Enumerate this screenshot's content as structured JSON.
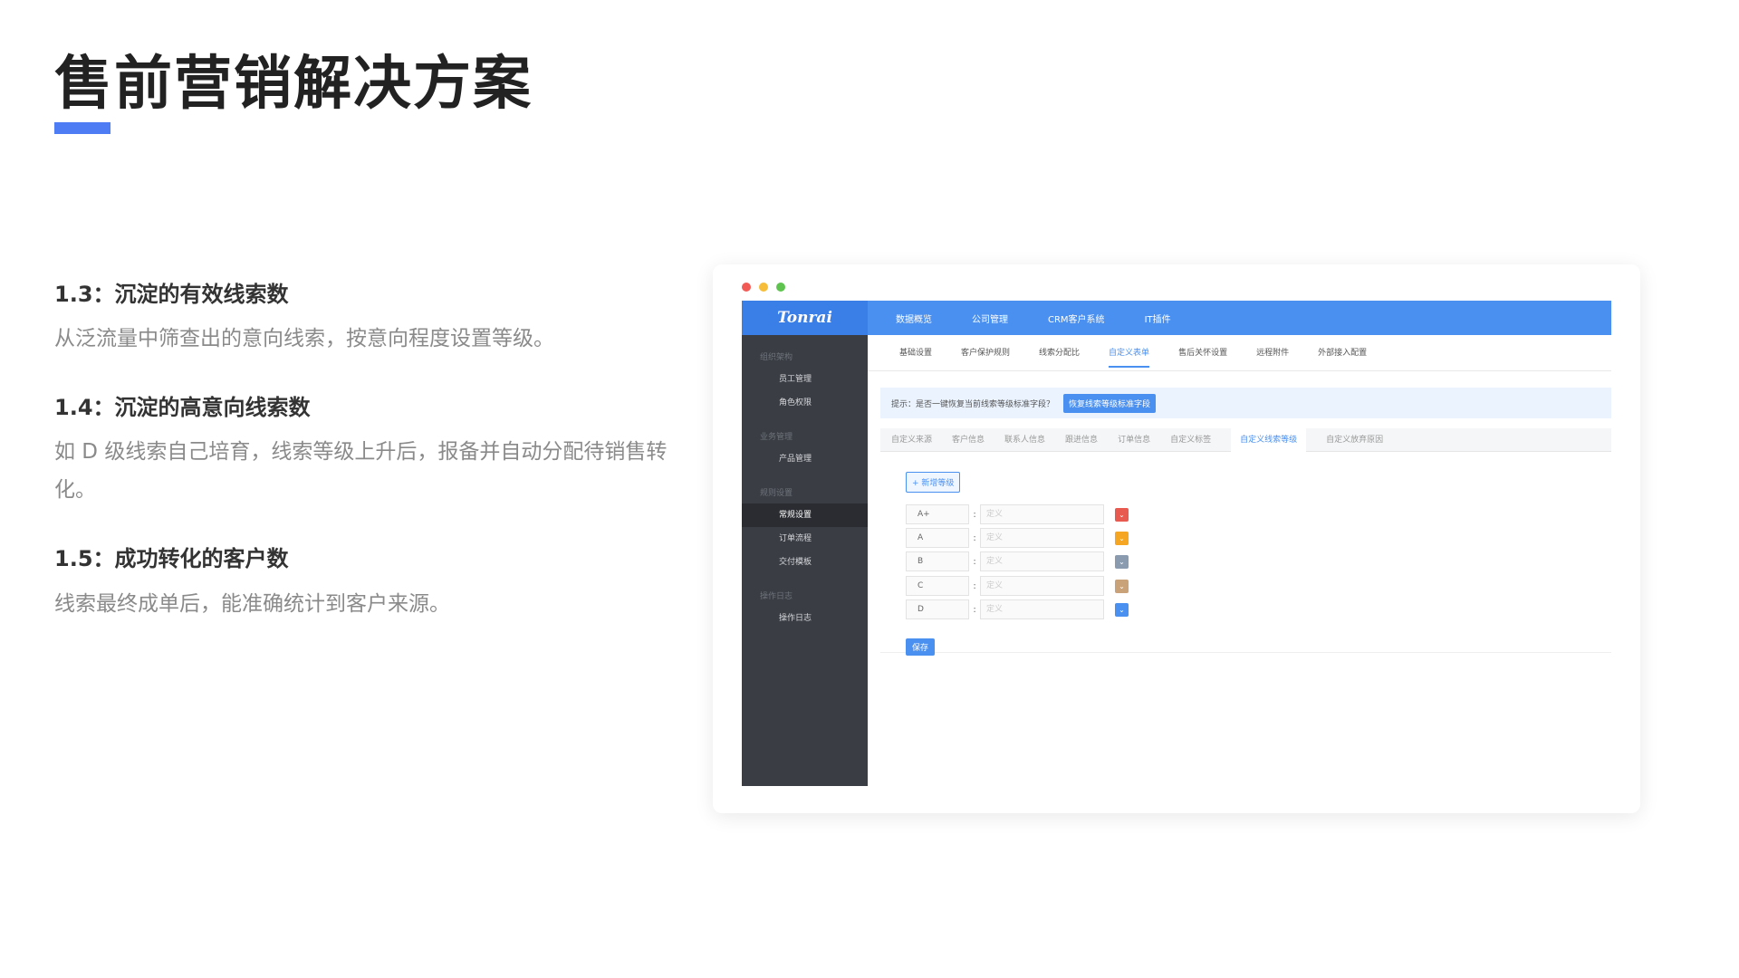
{
  "page": {
    "title": "售前营销解决方案",
    "accent_color": "#4d7cf4"
  },
  "sections": [
    {
      "heading": "1.3：沉淀的有效线索数",
      "text": "从泛流量中筛查出的意向线索，按意向程度设置等级。"
    },
    {
      "heading": "1.4：沉淀的高意向线索数",
      "text": "如 D 级线索自己培育，线索等级上升后，报备并自动分配待销售转化。"
    },
    {
      "heading": "1.5：成功转化的客户数",
      "text": "线索最终成单后，能准确统计到客户来源。"
    }
  ],
  "window_dots": [
    "#f25a55",
    "#f5bd3a",
    "#5ec34f"
  ],
  "app": {
    "logo": "Tonrai",
    "top_nav": [
      "数据概览",
      "公司管理",
      "CRM客户系统",
      "IT插件"
    ],
    "sidebar": [
      {
        "group": "组织架构",
        "items": [
          "员工管理",
          "角色权限"
        ]
      },
      {
        "group": "业务管理",
        "items": [
          "产品管理"
        ]
      },
      {
        "group": "规则设置",
        "items": [
          "常规设置",
          "订单流程",
          "交付模板"
        ]
      },
      {
        "group": "操作日志",
        "items": [
          "操作日志"
        ]
      }
    ],
    "sidebar_active": "常规设置",
    "tabs": [
      "基础设置",
      "客户保护规则",
      "线索分配比",
      "自定义表单",
      "售后关怀设置",
      "远程附件",
      "外部接入配置"
    ],
    "tabs_active": "自定义表单",
    "hint_text": "提示：是否一键恢复当前线索等级标准字段？",
    "hint_button": "恢复线索等级标准字段",
    "subtabs": [
      "自定义来源",
      "客户信息",
      "联系人信息",
      "跟进信息",
      "订单信息",
      "自定义标签",
      "自定义线索等级",
      "自定义放弃原因"
    ],
    "subtabs_active": "自定义线索等级",
    "add_button": "+ 新增等级",
    "definition_placeholder": "定义",
    "levels": [
      {
        "name": "A+",
        "color": "#e85a4f"
      },
      {
        "name": "A",
        "color": "#f5a623"
      },
      {
        "name": "B",
        "color": "#8a9bb0"
      },
      {
        "name": "C",
        "color": "#c9a27a"
      },
      {
        "name": "D",
        "color": "#4a90f0"
      }
    ],
    "save_button": "保存"
  }
}
